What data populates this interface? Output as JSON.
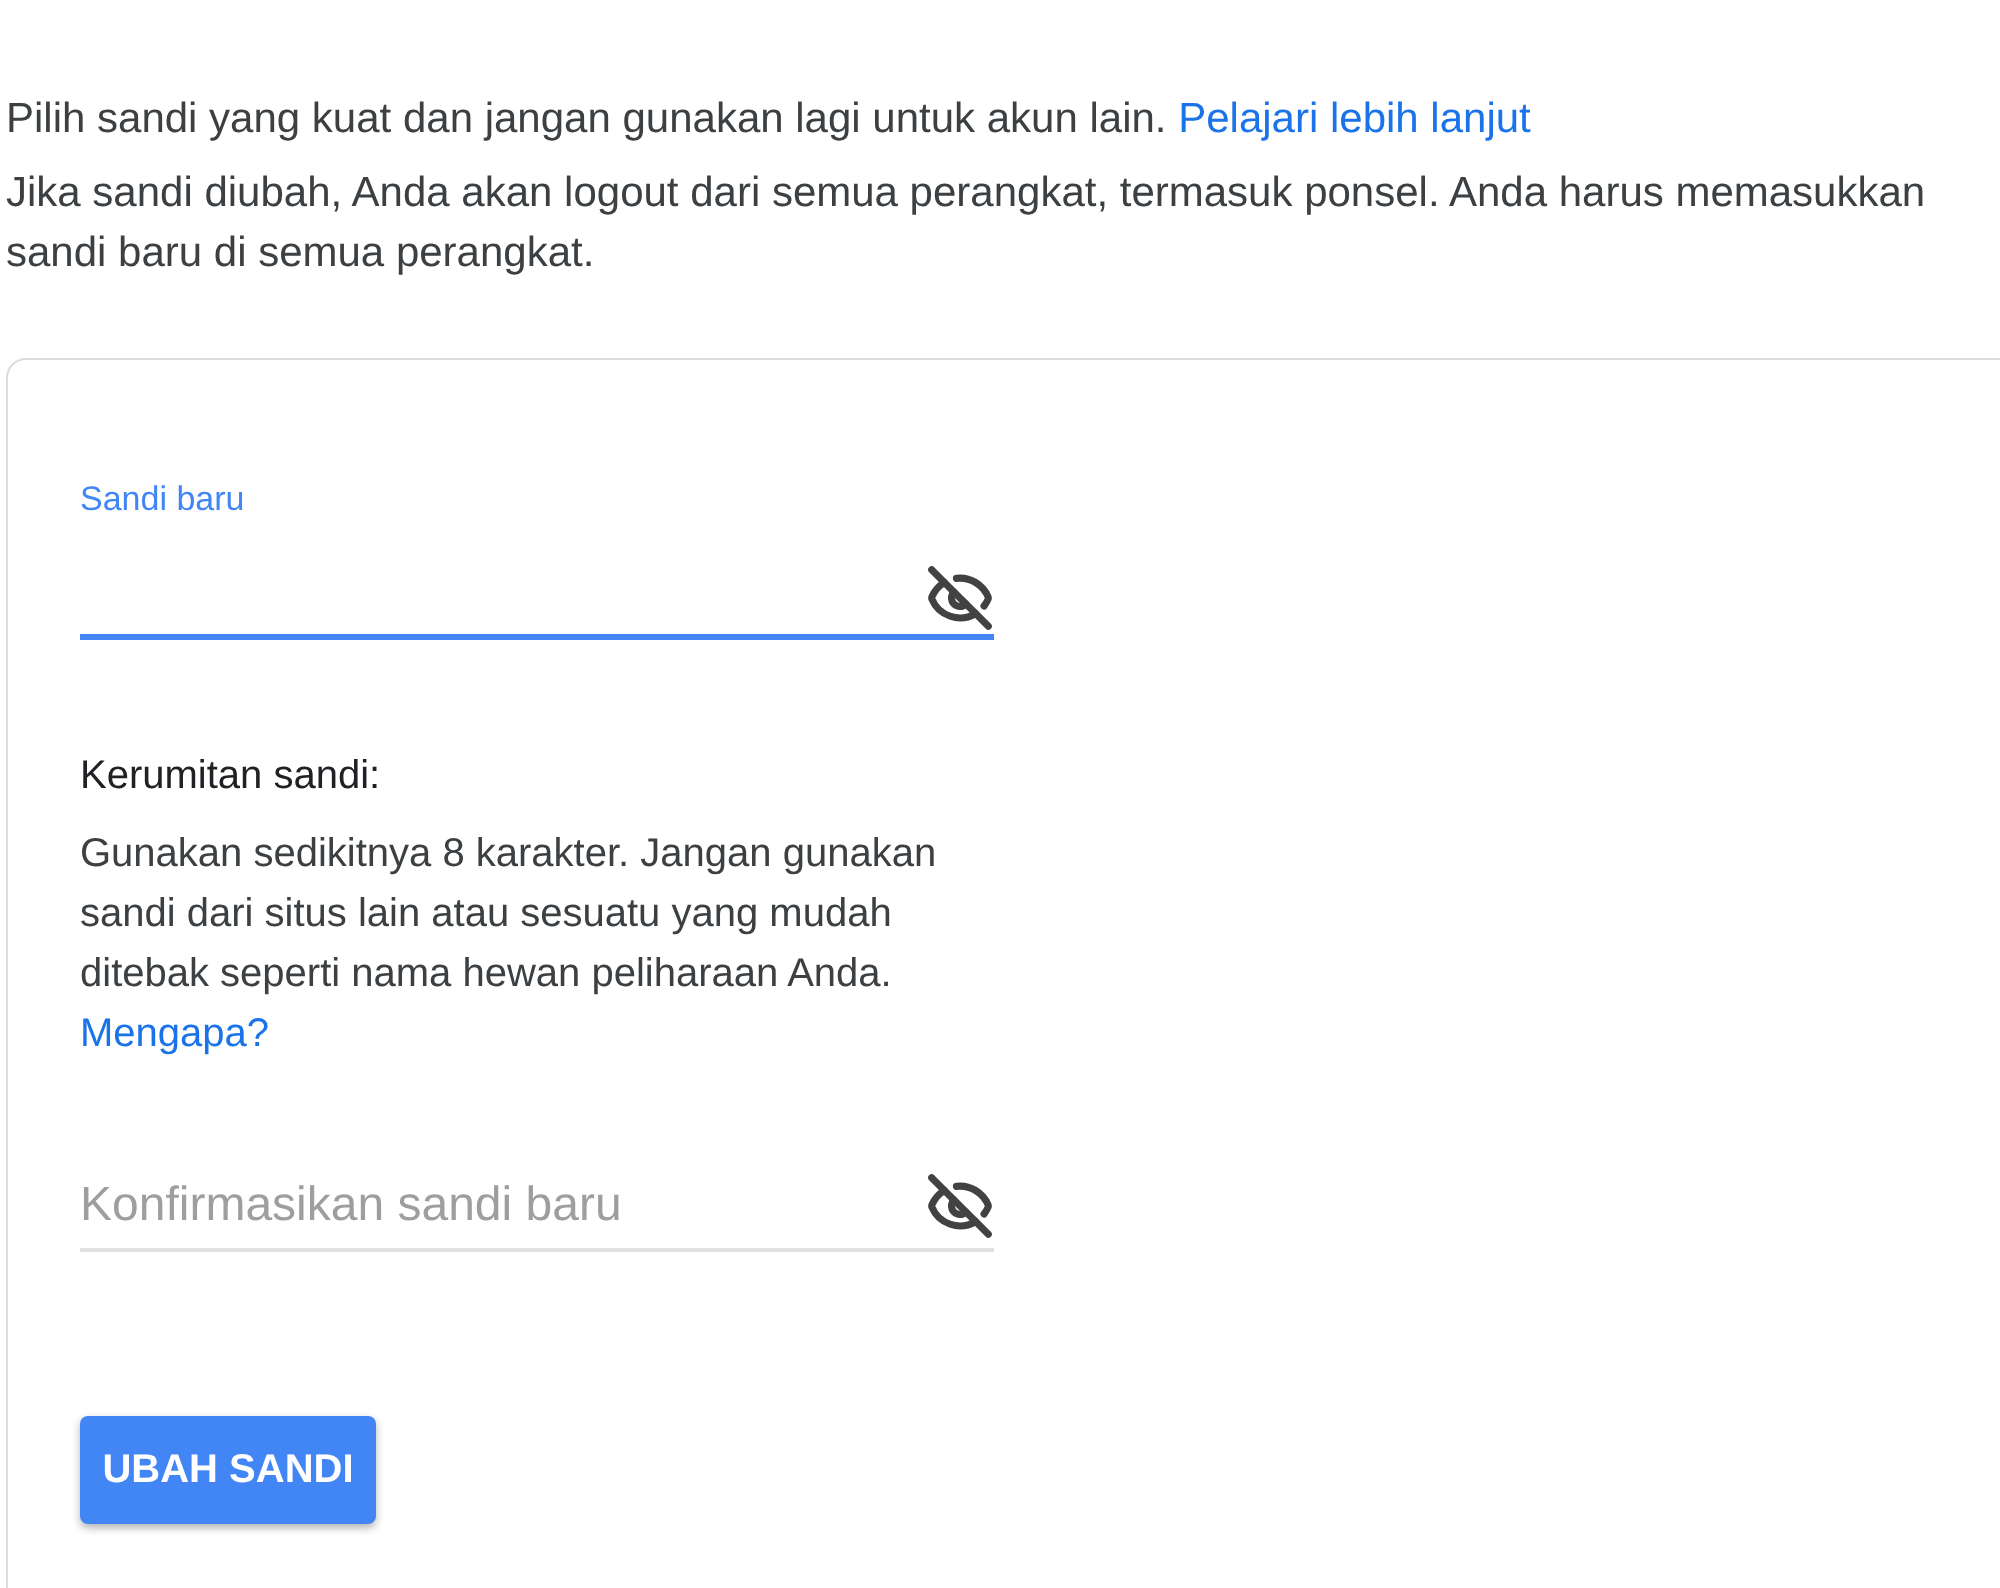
{
  "intro": {
    "text": "Pilih sandi yang kuat dan jangan gunakan lagi untuk akun lain.",
    "link": "Pelajari lebih lanjut"
  },
  "notice": "Jika sandi diubah, Anda akan logout dari semua perangkat, termasuk ponsel. Anda harus memasukkan sandi baru di semua perangkat.",
  "new_password": {
    "label": "Sandi baru",
    "focused": true
  },
  "strength": {
    "title": "Kerumitan sandi:",
    "text": "Gunakan sedikitnya 8 karakter. Jangan gunakan sandi dari situs lain atau sesuatu yang mudah ditebak seperti nama hewan peliharaan Anda.",
    "link": "Mengapa?"
  },
  "confirm_password": {
    "placeholder": "Konfirmasikan sandi baru",
    "focused": false
  },
  "submit": "UBAH SANDI"
}
